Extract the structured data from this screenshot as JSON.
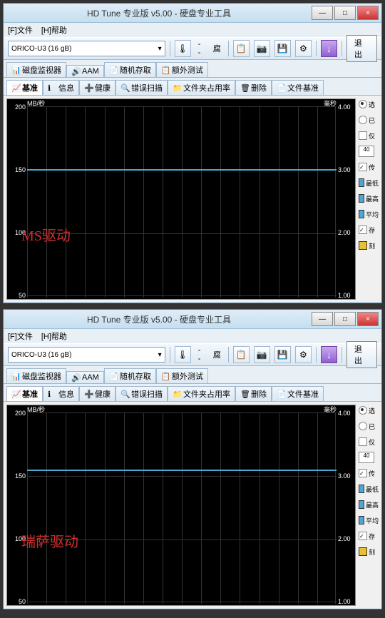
{
  "window": {
    "title": "HD Tune 专业版 v5.00 - 硬盘专业工具",
    "min": "—",
    "max": "□",
    "close": "×"
  },
  "menu": {
    "file": "[F]文件",
    "help": "[H]帮助"
  },
  "toolbar": {
    "drive": "ORICO-U3          (16 gB)",
    "temp_sep": "--",
    "temp_unit": "腐",
    "exit": "退出"
  },
  "tabs_row1": {
    "monitor": "磁盘监视器",
    "aam": "AAM",
    "random": "随机存取",
    "extra": "额外测试"
  },
  "tabs_row2": {
    "bench": "基准",
    "info": "信息",
    "health": "健康",
    "scan": "错误扫描",
    "folder": "文件夹占用率",
    "erase": "删除",
    "filebench": "文件基准"
  },
  "chart": {
    "y_unit_left": "MB/秒",
    "y_unit_right": "毫秒",
    "left_ticks": [
      "200",
      "150",
      "100",
      "50"
    ],
    "right_ticks": [
      "4.00",
      "3.00",
      "2.00",
      "1.00"
    ]
  },
  "overlay1": "MS驱动",
  "overlay2": "瑞萨驱动",
  "side": {
    "opt1": "选",
    "opt2": "已",
    "opt3": "仅",
    "val40": "40",
    "opt4": "传",
    "lbl_min": "最低",
    "lbl_max": "最高",
    "lbl_avg": "平均",
    "opt5": "存",
    "opt6": "刻"
  },
  "chart_data": [
    {
      "type": "line",
      "title": "MS驱动",
      "ylabel_left": "MB/秒",
      "ylabel_right": "毫秒",
      "ylim_left": [
        50,
        200
      ],
      "ylim_right": [
        1.0,
        4.0
      ],
      "series": [
        {
          "name": "传输速率",
          "approx_value": 150,
          "unit": "MB/秒",
          "note": "flat line around 150 MB/s across full range"
        }
      ]
    },
    {
      "type": "line",
      "title": "瑞萨驱动",
      "ylabel_left": "MB/秒",
      "ylabel_right": "毫秒",
      "ylim_left": [
        50,
        200
      ],
      "ylim_right": [
        1.0,
        4.0
      ],
      "series": [
        {
          "name": "传输速率",
          "approx_value": 155,
          "unit": "MB/秒",
          "note": "flat line around 155 MB/s across full range"
        }
      ]
    }
  ]
}
